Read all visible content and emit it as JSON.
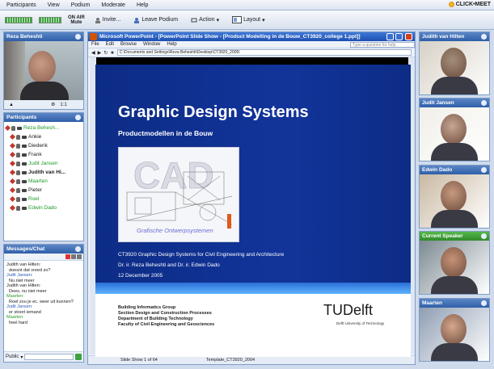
{
  "menubar": {
    "items": [
      "Participants",
      "View",
      "Podium",
      "Moderate",
      "Help"
    ],
    "brand": "CLICK•MEET"
  },
  "toolbar": {
    "onair_label": "ON AIR",
    "onair_sub": "Mute",
    "invite": "Invite...",
    "leave_podium": "Leave Podium",
    "action": "Action",
    "layout": "Layout"
  },
  "self_video": {
    "title": "Reza Beheshti"
  },
  "participants": {
    "title": "Participants",
    "rows": [
      {
        "name": "Reza Behesh...",
        "style": "green"
      },
      {
        "name": "Ankie",
        "style": "normal"
      },
      {
        "name": "Diederik",
        "style": "normal"
      },
      {
        "name": "Frank",
        "style": "normal"
      },
      {
        "name": "Judit Jansen",
        "style": "green"
      },
      {
        "name": "Judith van Hi...",
        "style": "bold"
      },
      {
        "name": "Maarten",
        "style": "green"
      },
      {
        "name": "Pieter",
        "style": "normal"
      },
      {
        "name": "Roel",
        "style": "green"
      },
      {
        "name": "Edwin Dado",
        "style": "green"
      }
    ]
  },
  "chat": {
    "title": "Messages/Chat",
    "lines": [
      {
        "text": "Judith van Hilten:",
        "color": "normal"
      },
      {
        "text": "  doesnt dat vreed zo?",
        "color": "normal"
      },
      {
        "text": "Judit Jansen:",
        "color": "blue"
      },
      {
        "text": "  Nu niet meer",
        "color": "normal"
      },
      {
        "text": "Judith van Hilten:",
        "color": "normal"
      },
      {
        "text": "  Dees, nu niet meer",
        "color": "normal"
      },
      {
        "text": "Maarten:",
        "color": "green"
      },
      {
        "text": "  Roel zou je ec. weer uit kunnen?",
        "color": "normal"
      },
      {
        "text": "Judit Jansen:",
        "color": "blue"
      },
      {
        "text": "  er stoort iemand",
        "color": "normal"
      },
      {
        "text": "Maarten:",
        "color": "green"
      },
      {
        "text": "  heel hard",
        "color": "normal"
      }
    ],
    "scope": "Public"
  },
  "ppt": {
    "window_title": "Microsoft PowerPoint - [PowerPoint Slide Show - [Product Modelling in de Bouw_CT3920_college 1.ppt]]",
    "menu": [
      "File",
      "Edit",
      "Browse",
      "Window",
      "Help"
    ],
    "address": "C:\\Documents and Settings\\Reza Beheshti\\Desktop\\CT3920_2005\\",
    "ask": "Type a question for help",
    "slide": {
      "title": "Graphic Design Systems",
      "subtitle": "Productmodellen in de Bouw",
      "image_caption": "Grafische Ontwerpsystemen",
      "course": "CT3920 Graphic Design Systems for Civil Engineering and Architecture",
      "authors": "Dr. ir. Reza Beheshti  and  Dr. ir. Edwin Dado",
      "date": "12 December 2005",
      "footer_lines": [
        "Building Informatics Group",
        "Section Design and Construction Processes",
        "Department of Building Technology",
        "Faculty of Civil Engineering and Geosciences"
      ],
      "logo": "TUDelft",
      "logo_sub": "Delft University of Technology"
    },
    "status_left": "Slide Show 1 of 64",
    "status_right": "Template_CT3920_2004"
  },
  "right_videos": [
    {
      "title": "Judith van Hilten"
    },
    {
      "title": "Judit Jansen"
    },
    {
      "title": "Edwin Dado"
    },
    {
      "title": "Current Speaker"
    },
    {
      "title": "Maarten"
    }
  ],
  "colors": {
    "header_blue": "#2f5fa8",
    "speaker_green": "#2f8a2a",
    "slide_blue": "#12349a"
  }
}
